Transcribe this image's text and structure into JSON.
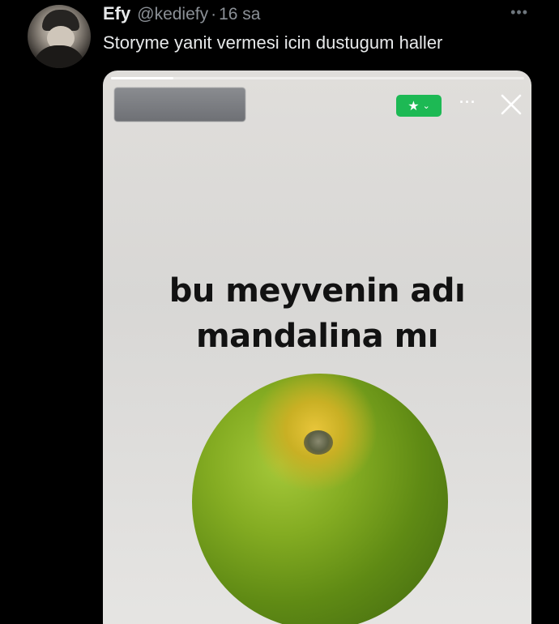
{
  "tweet": {
    "author_name": "Efy",
    "handle": "@kediefy",
    "separator": "·",
    "time": "16 sa",
    "more_icon": "more-horizontal-icon",
    "text": "Storyme yanit vermesi icin dustugum haller"
  },
  "story": {
    "progress": 0.15,
    "badge_icon": "star-icon",
    "badge_chevron_icon": "chevron-down-icon",
    "badge_color": "#1db954",
    "menu_icon": "more-horizontal-icon",
    "close_icon": "close-icon",
    "caption_line1": "bu meyvenin adı",
    "caption_line2": "mandalina mı"
  }
}
